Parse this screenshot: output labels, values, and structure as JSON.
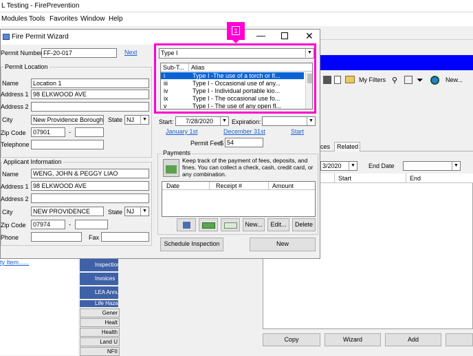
{
  "app": {
    "title": "L Testing - FirePrevention",
    "menu": [
      "Modules",
      "Tools",
      "Favorites",
      "Window",
      "Help"
    ]
  },
  "dialog": {
    "title": "Fire Permit Wizard",
    "permit_number_label": "Permit Number:",
    "permit_number": "FF-20-017",
    "next_link": "Next",
    "permit_location": {
      "group_label": "Permit Location",
      "name_label": "Name",
      "name": "Location 1",
      "address1_label": "Address 1",
      "address1": "98 ELKWOOD AVE",
      "address2_label": "Address 2",
      "address2": "",
      "city_label": "City",
      "city": "New Providence Borough",
      "state_label": "State",
      "state": "NJ",
      "zip_label": "Zip Code",
      "zip": "07901",
      "zip_sep": "-",
      "zip_ext": "",
      "telephone_label": "Telephone",
      "telephone": ""
    },
    "applicant": {
      "group_label": "Applicant Information",
      "name_label": "Name",
      "name": "WENG, JOHN & PEGGY LIAO",
      "address1_label": "Address 1",
      "address1": "98 ELKWOOD AVE",
      "address2_label": "Address 2",
      "address2": "",
      "city_label": "City",
      "city": "NEW PROVIDENCE",
      "state_label": "State",
      "state": "NJ",
      "zip_label": "Zip Code",
      "zip": "07974",
      "zip_sep": "-",
      "zip_ext": "",
      "phone_label": "Phone",
      "phone": "",
      "fax_label": "Fax",
      "fax": ""
    },
    "type_select": "Type I",
    "subtype_list": {
      "headers": [
        "Sub-T...",
        "Alias"
      ],
      "rows": [
        {
          "sub": "i",
          "alias": "Type I -The use of a torch or fl..."
        },
        {
          "sub": "iii",
          "alias": "Type I - Occasional use of any..."
        },
        {
          "sub": "iv",
          "alias": "Type I - Individual portable kio..."
        },
        {
          "sub": "ix",
          "alias": "Type I - The occasional use fo..."
        },
        {
          "sub": "v",
          "alias": "Type I - The use of any open fl..."
        }
      ]
    },
    "start_label": "Start:",
    "start_date": "7/28/2020",
    "expiration_label": "Expiration:",
    "expiration_date": "",
    "link_jan": "January 1st",
    "link_dec": "December 31st",
    "link_start": "Start",
    "permit_fee_label": "Permit Fee",
    "permit_fee_currency": "$",
    "permit_fee": "54",
    "payments": {
      "group_label": "Payments",
      "description": "Keep track of the payment of fees, deposits, and fines. You can collect a check, cash, credit card, or any combination.",
      "columns": [
        "Date",
        "Receipt #",
        "Amount"
      ],
      "btn_new": "New...",
      "btn_edit": "Edit...",
      "btn_delete": "Delete"
    },
    "btn_schedule": "Schedule Inspection",
    "btn_new": "New",
    "callout_number": "1"
  },
  "right_panel": {
    "my_filters": "My Filters",
    "new_label": "New...",
    "tabs": [
      "ces",
      "Related"
    ],
    "date_value": "3/2020",
    "end_date_label": "End Date",
    "grid_cols": [
      "Start",
      "End"
    ],
    "btn_copy": "Copy",
    "btn_wizard": "Wizard",
    "btn_add": "Add"
  },
  "left_panel": {
    "link_text": "ty Item......",
    "tree_items": [
      "Inspection",
      "Invoices",
      "LEA Annu",
      "Life Haza"
    ],
    "side_buttons": [
      "Gener",
      "Healt",
      "Health",
      "Land U",
      "NFII"
    ]
  },
  "colors": {
    "highlight": "#ff00d4",
    "selected_row": "#0a64d6",
    "blue_strip": "#0000ff",
    "link": "#1a5fd0"
  }
}
